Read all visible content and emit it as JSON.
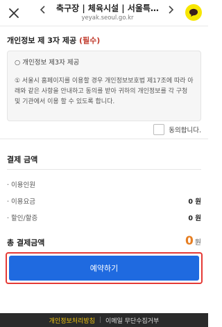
{
  "header": {
    "title": "축구장 | 체육시설 | 서울특…",
    "url": "yeyak.seoul.go.kr"
  },
  "consent": {
    "heading": "개인정보 제 3자 제공",
    "required": "(필수)",
    "box_title": "○ 개인정보 제3자 제공",
    "text": "① 서울시 홈페이지를 이용할 경우 개인정보보호법 제17조에 따라 아래와 같은 사항을 안내하고 동의를 받아 귀하의 개인정보를 각 구청 및 기관에서 이용 할 수 있도록 합니다.",
    "agree_label": "동의합니다."
  },
  "payment": {
    "heading": "결제 금액",
    "rows": [
      {
        "label": "· 이용인원",
        "value": ""
      },
      {
        "label": "· 이용요금",
        "value": "0 원"
      },
      {
        "label": "· 할인/할증",
        "value": "0 원"
      }
    ],
    "total_label": "총 결제금액",
    "total_value": "0",
    "total_unit": "원"
  },
  "reserve_button": "예약하기",
  "footer": {
    "policy": "개인정보처리방침",
    "separator": "|",
    "email": "이메일 무단수집거부"
  }
}
